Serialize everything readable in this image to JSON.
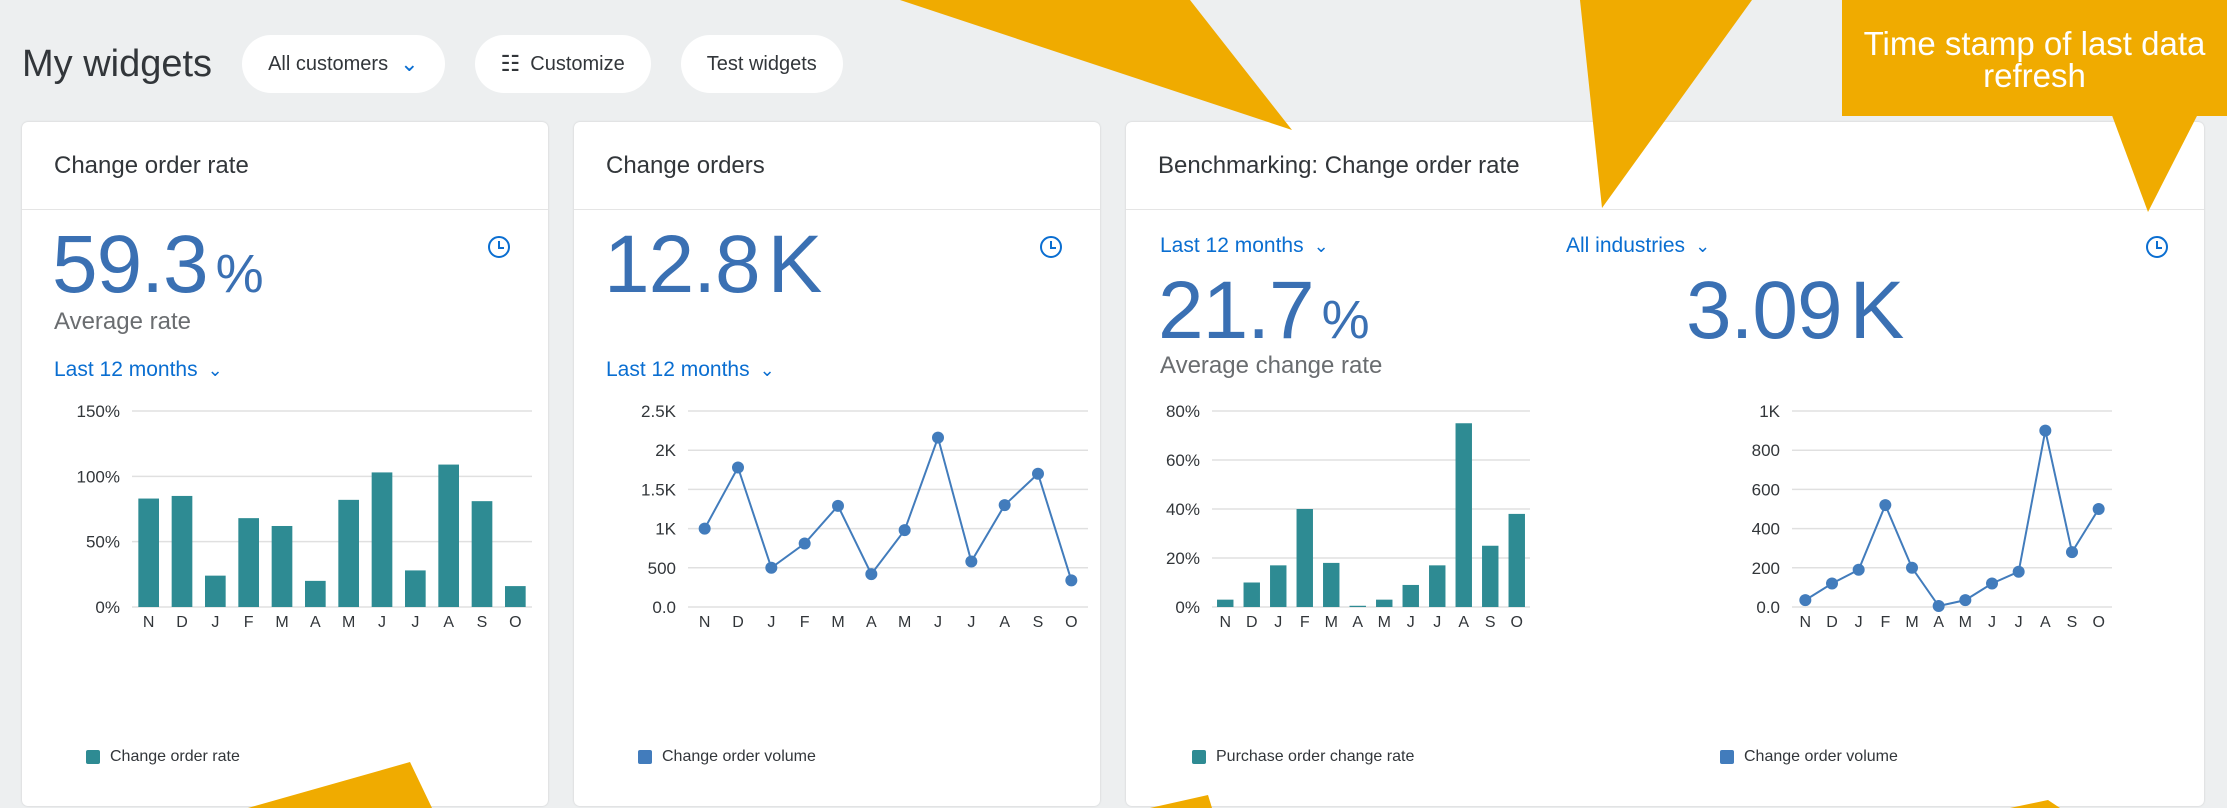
{
  "header": {
    "title": "My widgets",
    "customer_filter": "All customers",
    "customize_label": "Customize",
    "test_label": "Test widgets"
  },
  "cards": [
    {
      "title": "Change order rate",
      "kpi_value": "59.3",
      "kpi_unit": "%",
      "kpi_label": "Average rate",
      "period": "Last 12 months",
      "legend": "Change order rate"
    },
    {
      "title": "Change orders",
      "kpi_value": "12.8",
      "kpi_unit": "K",
      "period": "Last 12 months",
      "legend": "Change order volume"
    },
    {
      "title": "Benchmarking: Change order rate",
      "period": "Last 12 months",
      "industry": "All industries",
      "kpi_value": "21.7",
      "kpi_unit": "%",
      "kpi_label": "Average change rate",
      "kpi2_value": "3.09",
      "kpi2_unit": "K",
      "legend": "Purchase order change rate",
      "legend2": "Change order volume"
    }
  ],
  "callout": {
    "text": "Time stamp of last data refresh"
  },
  "colors": {
    "bar": "#2e8b93",
    "line": "#427cbc",
    "accent": "#0a6ed1",
    "callout": "#f0ab00"
  },
  "chart_data": [
    {
      "type": "bar",
      "categories": [
        "N",
        "D",
        "J",
        "F",
        "M",
        "A",
        "M",
        "J",
        "J",
        "A",
        "S",
        "O"
      ],
      "series": [
        {
          "name": "Change order rate",
          "values": [
            83,
            85,
            24,
            68,
            62,
            20,
            82,
            103,
            28,
            109,
            81,
            16
          ]
        }
      ],
      "yticks": [
        "0%",
        "50%",
        "100%",
        "150%"
      ],
      "ylim": [
        0,
        150
      ]
    },
    {
      "type": "line",
      "categories": [
        "N",
        "D",
        "J",
        "F",
        "M",
        "A",
        "M",
        "J",
        "J",
        "A",
        "S",
        "O"
      ],
      "series": [
        {
          "name": "Change order volume",
          "values": [
            1000,
            1780,
            500,
            810,
            1290,
            420,
            980,
            2160,
            580,
            1300,
            1700,
            340
          ]
        }
      ],
      "yticks": [
        "0.0",
        "500",
        "1K",
        "1.5K",
        "2K",
        "2.5K"
      ],
      "ylim": [
        0,
        2500
      ]
    },
    {
      "type": "bar",
      "categories": [
        "N",
        "D",
        "J",
        "F",
        "M",
        "A",
        "M",
        "J",
        "J",
        "A",
        "S",
        "O"
      ],
      "series": [
        {
          "name": "Purchase order change rate",
          "values": [
            3,
            10,
            17,
            40,
            18,
            0.5,
            3,
            9,
            17,
            75,
            25,
            38
          ]
        }
      ],
      "yticks": [
        "0%",
        "20%",
        "40%",
        "60%",
        "80%"
      ],
      "ylim": [
        0,
        80
      ]
    },
    {
      "type": "line",
      "categories": [
        "N",
        "D",
        "J",
        "F",
        "M",
        "A",
        "M",
        "J",
        "J",
        "A",
        "S",
        "O"
      ],
      "series": [
        {
          "name": "Change order volume",
          "values": [
            35,
            120,
            190,
            520,
            200,
            5,
            35,
            120,
            180,
            900,
            280,
            500
          ]
        }
      ],
      "yticks": [
        "0.0",
        "200",
        "400",
        "600",
        "800",
        "1K"
      ],
      "ylim": [
        0,
        1000
      ]
    }
  ]
}
